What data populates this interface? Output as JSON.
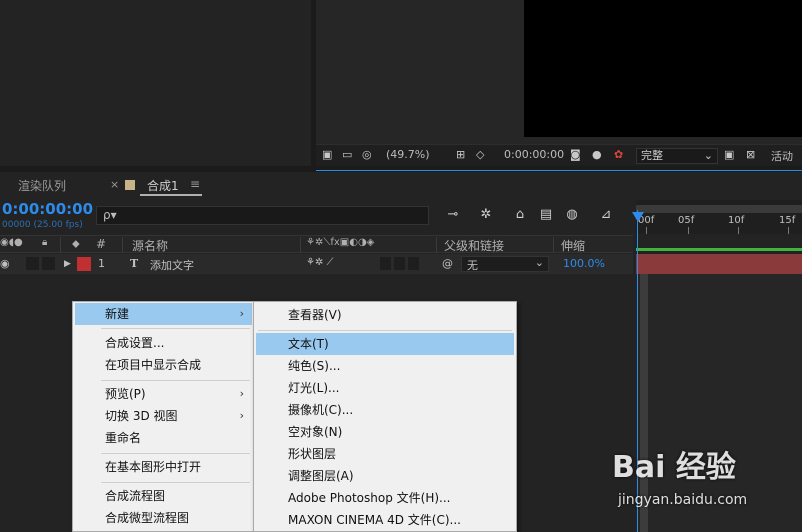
{
  "tabs": {
    "render_queue": "渲染队列",
    "close_symbol": "×",
    "comp_tab": "合成1",
    "menu_symbol": "≡"
  },
  "viewer_bar": {
    "zoom": "(49.7%)",
    "timecode": "0:00:00:00",
    "quality": "完整",
    "active_camera": "活动摄"
  },
  "timeline": {
    "timecode": "0:00:00:00",
    "fps": "00000 (25.00 fps)",
    "search_placeholder": "ρ▾",
    "columns": {
      "hash": "#",
      "source_name": "源名称",
      "parent": "父级和链接",
      "stretch": "伸缩"
    },
    "layer": {
      "index": "1",
      "type_icon": "T",
      "name": "添加文字",
      "parent_value": "无",
      "stretch": "100.0%"
    },
    "ruler_labels": [
      "00f",
      "05f",
      "10f",
      "15f"
    ]
  },
  "context_menu": {
    "items": [
      {
        "label": "新建",
        "submenu": true,
        "highlighted": true
      },
      {
        "label": "合成设置..."
      },
      {
        "label": "在项目中显示合成"
      },
      {
        "label": "预览(P)",
        "submenu": true
      },
      {
        "label": "切换 3D 视图",
        "submenu": true
      },
      {
        "label": "重命名"
      },
      {
        "label": "在基本图形中打开"
      },
      {
        "label": "合成流程图"
      },
      {
        "label": "合成微型流程图"
      }
    ]
  },
  "submenu": {
    "items": [
      {
        "label": "查看器(V)"
      },
      {
        "label": "文本(T)",
        "highlighted": true
      },
      {
        "label": "纯色(S)..."
      },
      {
        "label": "灯光(L)..."
      },
      {
        "label": "摄像机(C)..."
      },
      {
        "label": "空对象(N)"
      },
      {
        "label": "形状图层"
      },
      {
        "label": "调整图层(A)"
      },
      {
        "label": "Adobe Photoshop 文件(H)..."
      },
      {
        "label": "MAXON CINEMA 4D 文件(C)..."
      }
    ]
  },
  "watermark": {
    "brand": "Bai 经验",
    "url": "jingyan.baidu.com"
  },
  "colors": {
    "accent": "#2d8ceb",
    "menu_highlight": "#99c9ef",
    "layer_label": "#c03030"
  }
}
